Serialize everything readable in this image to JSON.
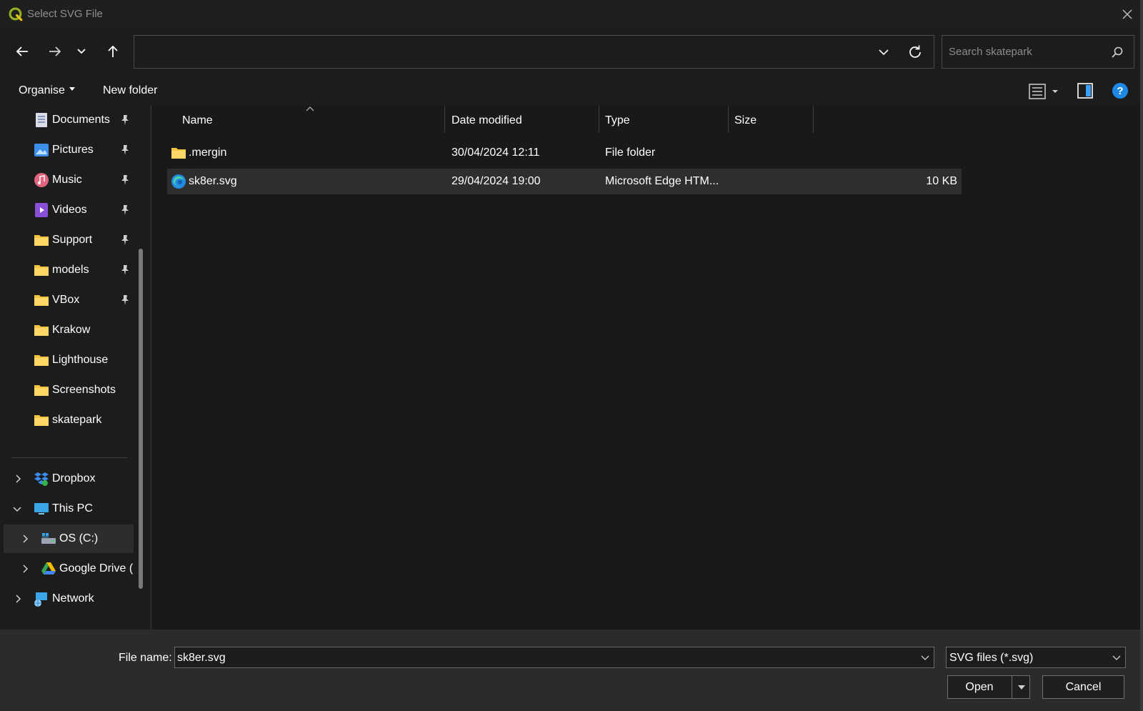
{
  "window": {
    "title": "Select SVG File"
  },
  "nav": {
    "address_value": "",
    "search_placeholder": "Search skatepark"
  },
  "toolbar": {
    "organise_label": "Organise",
    "new_folder_label": "New folder"
  },
  "sidebar": {
    "quick_access": [
      {
        "label": "Documents",
        "icon": "documents-icon",
        "pinned": true
      },
      {
        "label": "Pictures",
        "icon": "pictures-icon",
        "pinned": true
      },
      {
        "label": "Music",
        "icon": "music-icon",
        "pinned": true
      },
      {
        "label": "Videos",
        "icon": "videos-icon",
        "pinned": true
      },
      {
        "label": "Support",
        "icon": "folder-icon",
        "pinned": true
      },
      {
        "label": "models",
        "icon": "folder-icon",
        "pinned": true
      },
      {
        "label": "VBox",
        "icon": "folder-icon",
        "pinned": true
      },
      {
        "label": "Krakow",
        "icon": "folder-icon",
        "pinned": false
      },
      {
        "label": "Lighthouse",
        "icon": "folder-icon",
        "pinned": false
      },
      {
        "label": "Screenshots",
        "icon": "folder-icon",
        "pinned": false
      },
      {
        "label": "skatepark",
        "icon": "folder-icon",
        "pinned": false
      }
    ],
    "locations": [
      {
        "label": "Dropbox",
        "icon": "dropbox-icon",
        "expanded": false
      },
      {
        "label": "This PC",
        "icon": "pc-icon",
        "expanded": true
      },
      {
        "label": "OS (C:)",
        "icon": "drive-icon",
        "expanded": false,
        "selected": true
      },
      {
        "label": "Google Drive (",
        "icon": "google-drive-icon",
        "expanded": false
      },
      {
        "label": "Network",
        "icon": "network-icon",
        "expanded": false
      }
    ]
  },
  "columns": {
    "name": "Name",
    "date": "Date modified",
    "type": "Type",
    "size": "Size"
  },
  "files": [
    {
      "name": ".mergin",
      "date": "30/04/2024 12:11",
      "type": "File folder",
      "size": "",
      "icon": "folder-icon"
    },
    {
      "name": "sk8er.svg",
      "date": "29/04/2024 19:00",
      "type": "Microsoft Edge HTM...",
      "size": "10 KB",
      "icon": "edge-icon"
    }
  ],
  "footer": {
    "file_name_label": "File name:",
    "file_name_value": "sk8er.svg",
    "file_type_value": "SVG files (*.svg)",
    "open_label": "Open",
    "cancel_label": "Cancel"
  },
  "colors": {
    "accent": "#0078d4",
    "folder": "#f4c542",
    "background": "#191919"
  }
}
